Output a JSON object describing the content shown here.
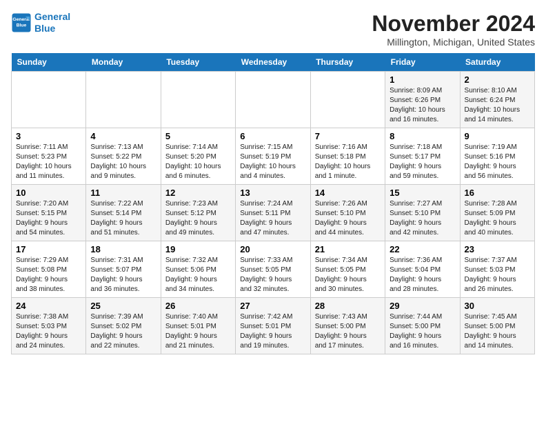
{
  "header": {
    "logo_line1": "General",
    "logo_line2": "Blue",
    "month": "November 2024",
    "location": "Millington, Michigan, United States"
  },
  "weekdays": [
    "Sunday",
    "Monday",
    "Tuesday",
    "Wednesday",
    "Thursday",
    "Friday",
    "Saturday"
  ],
  "weeks": [
    [
      {
        "day": "",
        "info": ""
      },
      {
        "day": "",
        "info": ""
      },
      {
        "day": "",
        "info": ""
      },
      {
        "day": "",
        "info": ""
      },
      {
        "day": "",
        "info": ""
      },
      {
        "day": "1",
        "info": "Sunrise: 8:09 AM\nSunset: 6:26 PM\nDaylight: 10 hours\nand 16 minutes."
      },
      {
        "day": "2",
        "info": "Sunrise: 8:10 AM\nSunset: 6:24 PM\nDaylight: 10 hours\nand 14 minutes."
      }
    ],
    [
      {
        "day": "3",
        "info": "Sunrise: 7:11 AM\nSunset: 5:23 PM\nDaylight: 10 hours\nand 11 minutes."
      },
      {
        "day": "4",
        "info": "Sunrise: 7:13 AM\nSunset: 5:22 PM\nDaylight: 10 hours\nand 9 minutes."
      },
      {
        "day": "5",
        "info": "Sunrise: 7:14 AM\nSunset: 5:20 PM\nDaylight: 10 hours\nand 6 minutes."
      },
      {
        "day": "6",
        "info": "Sunrise: 7:15 AM\nSunset: 5:19 PM\nDaylight: 10 hours\nand 4 minutes."
      },
      {
        "day": "7",
        "info": "Sunrise: 7:16 AM\nSunset: 5:18 PM\nDaylight: 10 hours\nand 1 minute."
      },
      {
        "day": "8",
        "info": "Sunrise: 7:18 AM\nSunset: 5:17 PM\nDaylight: 9 hours\nand 59 minutes."
      },
      {
        "day": "9",
        "info": "Sunrise: 7:19 AM\nSunset: 5:16 PM\nDaylight: 9 hours\nand 56 minutes."
      }
    ],
    [
      {
        "day": "10",
        "info": "Sunrise: 7:20 AM\nSunset: 5:15 PM\nDaylight: 9 hours\nand 54 minutes."
      },
      {
        "day": "11",
        "info": "Sunrise: 7:22 AM\nSunset: 5:14 PM\nDaylight: 9 hours\nand 51 minutes."
      },
      {
        "day": "12",
        "info": "Sunrise: 7:23 AM\nSunset: 5:12 PM\nDaylight: 9 hours\nand 49 minutes."
      },
      {
        "day": "13",
        "info": "Sunrise: 7:24 AM\nSunset: 5:11 PM\nDaylight: 9 hours\nand 47 minutes."
      },
      {
        "day": "14",
        "info": "Sunrise: 7:26 AM\nSunset: 5:10 PM\nDaylight: 9 hours\nand 44 minutes."
      },
      {
        "day": "15",
        "info": "Sunrise: 7:27 AM\nSunset: 5:10 PM\nDaylight: 9 hours\nand 42 minutes."
      },
      {
        "day": "16",
        "info": "Sunrise: 7:28 AM\nSunset: 5:09 PM\nDaylight: 9 hours\nand 40 minutes."
      }
    ],
    [
      {
        "day": "17",
        "info": "Sunrise: 7:29 AM\nSunset: 5:08 PM\nDaylight: 9 hours\nand 38 minutes."
      },
      {
        "day": "18",
        "info": "Sunrise: 7:31 AM\nSunset: 5:07 PM\nDaylight: 9 hours\nand 36 minutes."
      },
      {
        "day": "19",
        "info": "Sunrise: 7:32 AM\nSunset: 5:06 PM\nDaylight: 9 hours\nand 34 minutes."
      },
      {
        "day": "20",
        "info": "Sunrise: 7:33 AM\nSunset: 5:05 PM\nDaylight: 9 hours\nand 32 minutes."
      },
      {
        "day": "21",
        "info": "Sunrise: 7:34 AM\nSunset: 5:05 PM\nDaylight: 9 hours\nand 30 minutes."
      },
      {
        "day": "22",
        "info": "Sunrise: 7:36 AM\nSunset: 5:04 PM\nDaylight: 9 hours\nand 28 minutes."
      },
      {
        "day": "23",
        "info": "Sunrise: 7:37 AM\nSunset: 5:03 PM\nDaylight: 9 hours\nand 26 minutes."
      }
    ],
    [
      {
        "day": "24",
        "info": "Sunrise: 7:38 AM\nSunset: 5:03 PM\nDaylight: 9 hours\nand 24 minutes."
      },
      {
        "day": "25",
        "info": "Sunrise: 7:39 AM\nSunset: 5:02 PM\nDaylight: 9 hours\nand 22 minutes."
      },
      {
        "day": "26",
        "info": "Sunrise: 7:40 AM\nSunset: 5:01 PM\nDaylight: 9 hours\nand 21 minutes."
      },
      {
        "day": "27",
        "info": "Sunrise: 7:42 AM\nSunset: 5:01 PM\nDaylight: 9 hours\nand 19 minutes."
      },
      {
        "day": "28",
        "info": "Sunrise: 7:43 AM\nSunset: 5:00 PM\nDaylight: 9 hours\nand 17 minutes."
      },
      {
        "day": "29",
        "info": "Sunrise: 7:44 AM\nSunset: 5:00 PM\nDaylight: 9 hours\nand 16 minutes."
      },
      {
        "day": "30",
        "info": "Sunrise: 7:45 AM\nSunset: 5:00 PM\nDaylight: 9 hours\nand 14 minutes."
      }
    ]
  ]
}
